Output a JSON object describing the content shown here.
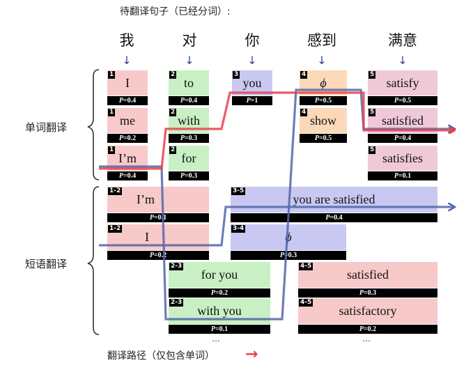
{
  "header": {
    "title": "待翻译句子（已经分词）:"
  },
  "source_words": [
    "我",
    "对",
    "你",
    "感到",
    "满意"
  ],
  "labels": {
    "word_translation": "单词翻译",
    "phrase_translation": "短语翻译"
  },
  "legend": {
    "text": "翻译路径（仅包含单词）",
    "arrow": "→"
  },
  "prob_prefix": "P",
  "ellipsis": "…",
  "colors": {
    "red_path": "#e8404a",
    "blue_path": "#5566aa",
    "red_cell": "#f8c9c9",
    "green_cell": "#c8f0c4",
    "purple_cell": "#c8c8f2",
    "orange_cell": "#fbd9b8",
    "pink_cell": "#f0c9d8"
  },
  "word_cells": [
    {
      "index": "1",
      "text": "I",
      "prob": "=0.4"
    },
    {
      "index": "1",
      "text": "me",
      "prob": "=0.2"
    },
    {
      "index": "1",
      "text": "I’m",
      "prob": "=0.4"
    },
    {
      "index": "2",
      "text": "to",
      "prob": "=0.4"
    },
    {
      "index": "2",
      "text": "with",
      "prob": "=0.3"
    },
    {
      "index": "2",
      "text": "for",
      "prob": "=0.3"
    },
    {
      "index": "3",
      "text": "you",
      "prob": "=1"
    },
    {
      "index": "4",
      "text": "ϕ",
      "prob": "=0.5"
    },
    {
      "index": "4",
      "text": "show",
      "prob": "=0.5"
    },
    {
      "index": "5",
      "text": "satisfy",
      "prob": "=0.5"
    },
    {
      "index": "5",
      "text": "satisfied",
      "prob": "=0.4"
    },
    {
      "index": "5",
      "text": "satisfies",
      "prob": "=0.1"
    }
  ],
  "phrase_cells": [
    {
      "index": "1-2",
      "text": "I’m",
      "prob": "=0.1"
    },
    {
      "index": "1-2",
      "text": "I",
      "prob": "=0.2"
    },
    {
      "index": "2-3",
      "text": "for you",
      "prob": "=0.2"
    },
    {
      "index": "2-3",
      "text": "with you",
      "prob": "=0.1"
    },
    {
      "index": "3-5",
      "text": "you are satisfied",
      "prob": "=0.4"
    },
    {
      "index": "3-4",
      "text": "ϕ",
      "prob": "=0.3"
    },
    {
      "index": "4-5",
      "text": "satisfied",
      "prob": "=0.3"
    },
    {
      "index": "4-5",
      "text": "satisfactory",
      "prob": "=0.2"
    }
  ]
}
